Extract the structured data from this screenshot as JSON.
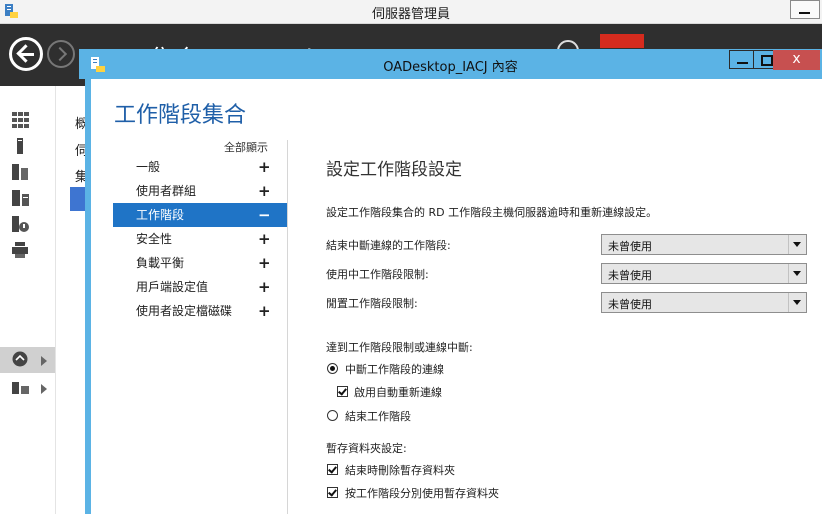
{
  "background_window": {
    "title": "伺服器管理員",
    "breadcrumb_partial": "集合 ▸ OADesktop_IACJ",
    "nav_partial": [
      "概",
      "伺",
      "集"
    ]
  },
  "dialog": {
    "title": "OADesktop_IACJ 內容",
    "heading": "工作階段集合",
    "close_glyph": "x"
  },
  "categories": {
    "show_all": "全部顯示",
    "items": [
      {
        "label": "一般",
        "sign": "+"
      },
      {
        "label": "使用者群組",
        "sign": "+"
      },
      {
        "label": "工作階段",
        "sign": "−"
      },
      {
        "label": "安全性",
        "sign": "+"
      },
      {
        "label": "負載平衡",
        "sign": "+"
      },
      {
        "label": "用戶端設定值",
        "sign": "+"
      },
      {
        "label": "使用者設定檔磁碟",
        "sign": "+"
      }
    ]
  },
  "settings": {
    "section_title": "設定工作階段設定",
    "description": "設定工作階段集合的 RD 工作階段主機伺服器逾時和重新連線設定。",
    "fields": [
      {
        "label": "結束中斷連線的工作階段:",
        "value": "未曾使用"
      },
      {
        "label": "使用中工作階段限制:",
        "value": "未曾使用"
      },
      {
        "label": "閒置工作階段限制:",
        "value": "未曾使用"
      }
    ],
    "limit_group_label": "達到工作階段限制或連線中斷:",
    "radio_disconnect": "中斷工作階段的連線",
    "checkbox_reconnect": "啟用自動重新連線",
    "radio_end": "結束工作階段",
    "temp_folder_label": "暫存資料夾設定:",
    "checkbox_delete_temp": "結束時刪除暫存資料夾",
    "checkbox_per_session_temp": "按工作階段分別使用暫存資料夾"
  }
}
